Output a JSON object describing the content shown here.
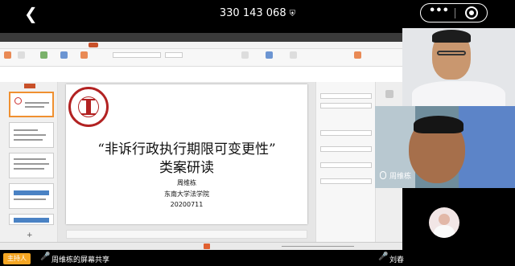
{
  "header": {
    "meeting_id": "330 143 068",
    "back_icon": "chevron-left",
    "shield_icon": "shield",
    "more_icon": "ellipsis",
    "close_icon": "target-circle"
  },
  "ppt_app": {
    "slide": {
      "title_line1": "“非诉行政执行期限可变更性”",
      "title_line2": "类案研读",
      "author": "周维栋",
      "affiliation": "东南大学法学院",
      "date": "20200711"
    }
  },
  "participants": [
    {
      "name": "周维栋",
      "camera": "on"
    },
    {
      "name": "刘春",
      "camera": "avatar"
    }
  ],
  "bottom": {
    "host_badge": "主持人",
    "share_label": "周维栋的屏幕共享",
    "speaker_name": "刘春"
  },
  "colors": {
    "host_badge": "#f5a623",
    "ppt_accent": "#c85029",
    "seal": "#b22222"
  }
}
